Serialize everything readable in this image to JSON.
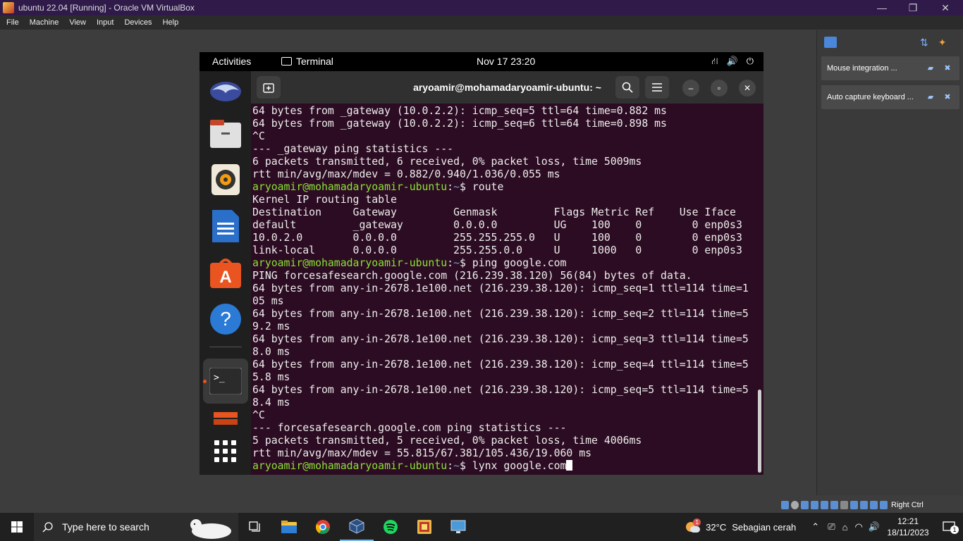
{
  "virtualbox": {
    "title": "ubuntu 22.04 [Running] - Oracle VM VirtualBox",
    "menu": [
      "File",
      "Machine",
      "View",
      "Input",
      "Devices",
      "Help"
    ],
    "window_controls": {
      "minimize": "—",
      "restore": "❐",
      "close": "✕"
    },
    "notifications": [
      {
        "label": "Mouse integration ..."
      },
      {
        "label": "Auto capture keyboard ..."
      }
    ],
    "status_host_key": "Right Ctrl"
  },
  "gnome": {
    "activities": "Activities",
    "app_name": "Terminal",
    "clock": "Nov 17  23:20"
  },
  "terminal": {
    "title": "aryoamir@mohamadaryoamir-ubuntu: ~",
    "prompt_user": "aryoamir@mohamadaryoamir-ubuntu",
    "prompt_dir": "~",
    "lines": [
      "64 bytes from _gateway (10.0.2.2): icmp_seq=5 ttl=64 time=0.882 ms",
      "64 bytes from _gateway (10.0.2.2): icmp_seq=6 ttl=64 time=0.898 ms",
      "^C",
      "--- _gateway ping statistics ---",
      "6 packets transmitted, 6 received, 0% packet loss, time 5009ms",
      "rtt min/avg/max/mdev = 0.882/0.940/1.036/0.055 ms",
      {
        "cmd": "route"
      },
      "Kernel IP routing table",
      "Destination     Gateway         Genmask         Flags Metric Ref    Use Iface",
      "default         _gateway        0.0.0.0         UG    100    0        0 enp0s3",
      "10.0.2.0        0.0.0.0         255.255.255.0   U     100    0        0 enp0s3",
      "link-local      0.0.0.0         255.255.0.0     U     1000   0        0 enp0s3",
      {
        "cmd": "ping google.com"
      },
      "PING forcesafesearch.google.com (216.239.38.120) 56(84) bytes of data.",
      "64 bytes from any-in-2678.1e100.net (216.239.38.120): icmp_seq=1 ttl=114 time=1",
      "05 ms",
      "64 bytes from any-in-2678.1e100.net (216.239.38.120): icmp_seq=2 ttl=114 time=5",
      "9.2 ms",
      "64 bytes from any-in-2678.1e100.net (216.239.38.120): icmp_seq=3 ttl=114 time=5",
      "8.0 ms",
      "64 bytes from any-in-2678.1e100.net (216.239.38.120): icmp_seq=4 ttl=114 time=5",
      "5.8 ms",
      "64 bytes from any-in-2678.1e100.net (216.239.38.120): icmp_seq=5 ttl=114 time=5",
      "8.4 ms",
      "^C",
      "--- forcesafesearch.google.com ping statistics ---",
      "5 packets transmitted, 5 received, 0% packet loss, time 4006ms",
      "rtt min/avg/max/mdev = 55.815/67.381/105.436/19.060 ms",
      {
        "cmd": "lynx google.com",
        "cursor": true
      }
    ]
  },
  "dock_apps": [
    "thunderbird-icon",
    "files-icon",
    "rhythmbox-icon",
    "libreoffice-writer-icon",
    "app-center-icon",
    "help-icon",
    "terminal-icon",
    "drive-icon",
    "show-apps-icon"
  ],
  "taskbar": {
    "search_placeholder": "Type here to search",
    "weather_temp": "32°C",
    "weather_desc": "Sebagian cerah",
    "weather_badge": "1",
    "time": "12:21",
    "date": "18/11/2023",
    "notification_count": "1"
  }
}
